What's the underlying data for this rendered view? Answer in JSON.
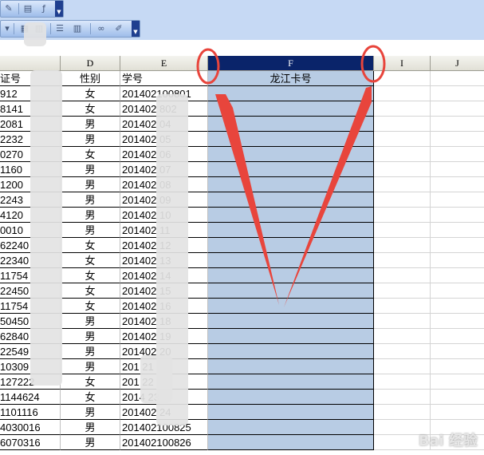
{
  "columns": [
    {
      "key": "c",
      "label": ""
    },
    {
      "key": "d",
      "label": "D"
    },
    {
      "key": "e",
      "label": "E"
    },
    {
      "key": "f",
      "label": "F"
    },
    {
      "key": "i",
      "label": "I"
    },
    {
      "key": "j",
      "label": "J"
    }
  ],
  "header_row": {
    "c": "证号",
    "d": "性别",
    "e": "学号",
    "f": "龙江卡号"
  },
  "rows": [
    {
      "c": "912",
      "d": "女",
      "e": "201402100801"
    },
    {
      "c": "8141",
      "d": "女",
      "e": "201402   802"
    },
    {
      "c": "2081",
      "d": "男",
      "e": "201402   04"
    },
    {
      "c": "2232",
      "d": "男",
      "e": "201402   05"
    },
    {
      "c": "0270",
      "d": "女",
      "e": "201402   06"
    },
    {
      "c": "1160",
      "d": "男",
      "e": "201402   07"
    },
    {
      "c": "1200",
      "d": "男",
      "e": "201402   08"
    },
    {
      "c": "2243",
      "d": "男",
      "e": "201402   09"
    },
    {
      "c": "4120",
      "d": "男",
      "e": "201402   10"
    },
    {
      "c": "0010",
      "d": "男",
      "e": "201402   11"
    },
    {
      "c": "62240",
      "d": "女",
      "e": "201402   12"
    },
    {
      "c": "22340",
      "d": "女",
      "e": "201402   13"
    },
    {
      "c": "11754",
      "d": "女",
      "e": "201402   14"
    },
    {
      "c": "22450",
      "d": "女",
      "e": "201402   15"
    },
    {
      "c": "11754",
      "d": "女",
      "e": "201402   16"
    },
    {
      "c": "50450",
      "d": "男",
      "e": "201402   18"
    },
    {
      "c": "62840",
      "d": "男",
      "e": "201402   19"
    },
    {
      "c": "22549",
      "d": "男",
      "e": "201402   20"
    },
    {
      "c": "10309",
      "d": "男",
      "e": "201   21"
    },
    {
      "c": "127222",
      "d": "女",
      "e": "201   22"
    },
    {
      "c": "1144624",
      "d": "女",
      "e": "2014   23"
    },
    {
      "c": "1101116",
      "d": "男",
      "e": "201402   24"
    },
    {
      "c": "4030016",
      "d": "男",
      "e": "201402100825"
    },
    {
      "c": "6070316",
      "d": "男",
      "e": "201402100826"
    }
  ],
  "watermark": "Bai 经验",
  "colors": {
    "selection": "#b8cce4",
    "header_selected": "#0a246a",
    "annotation": "#e8453c"
  }
}
